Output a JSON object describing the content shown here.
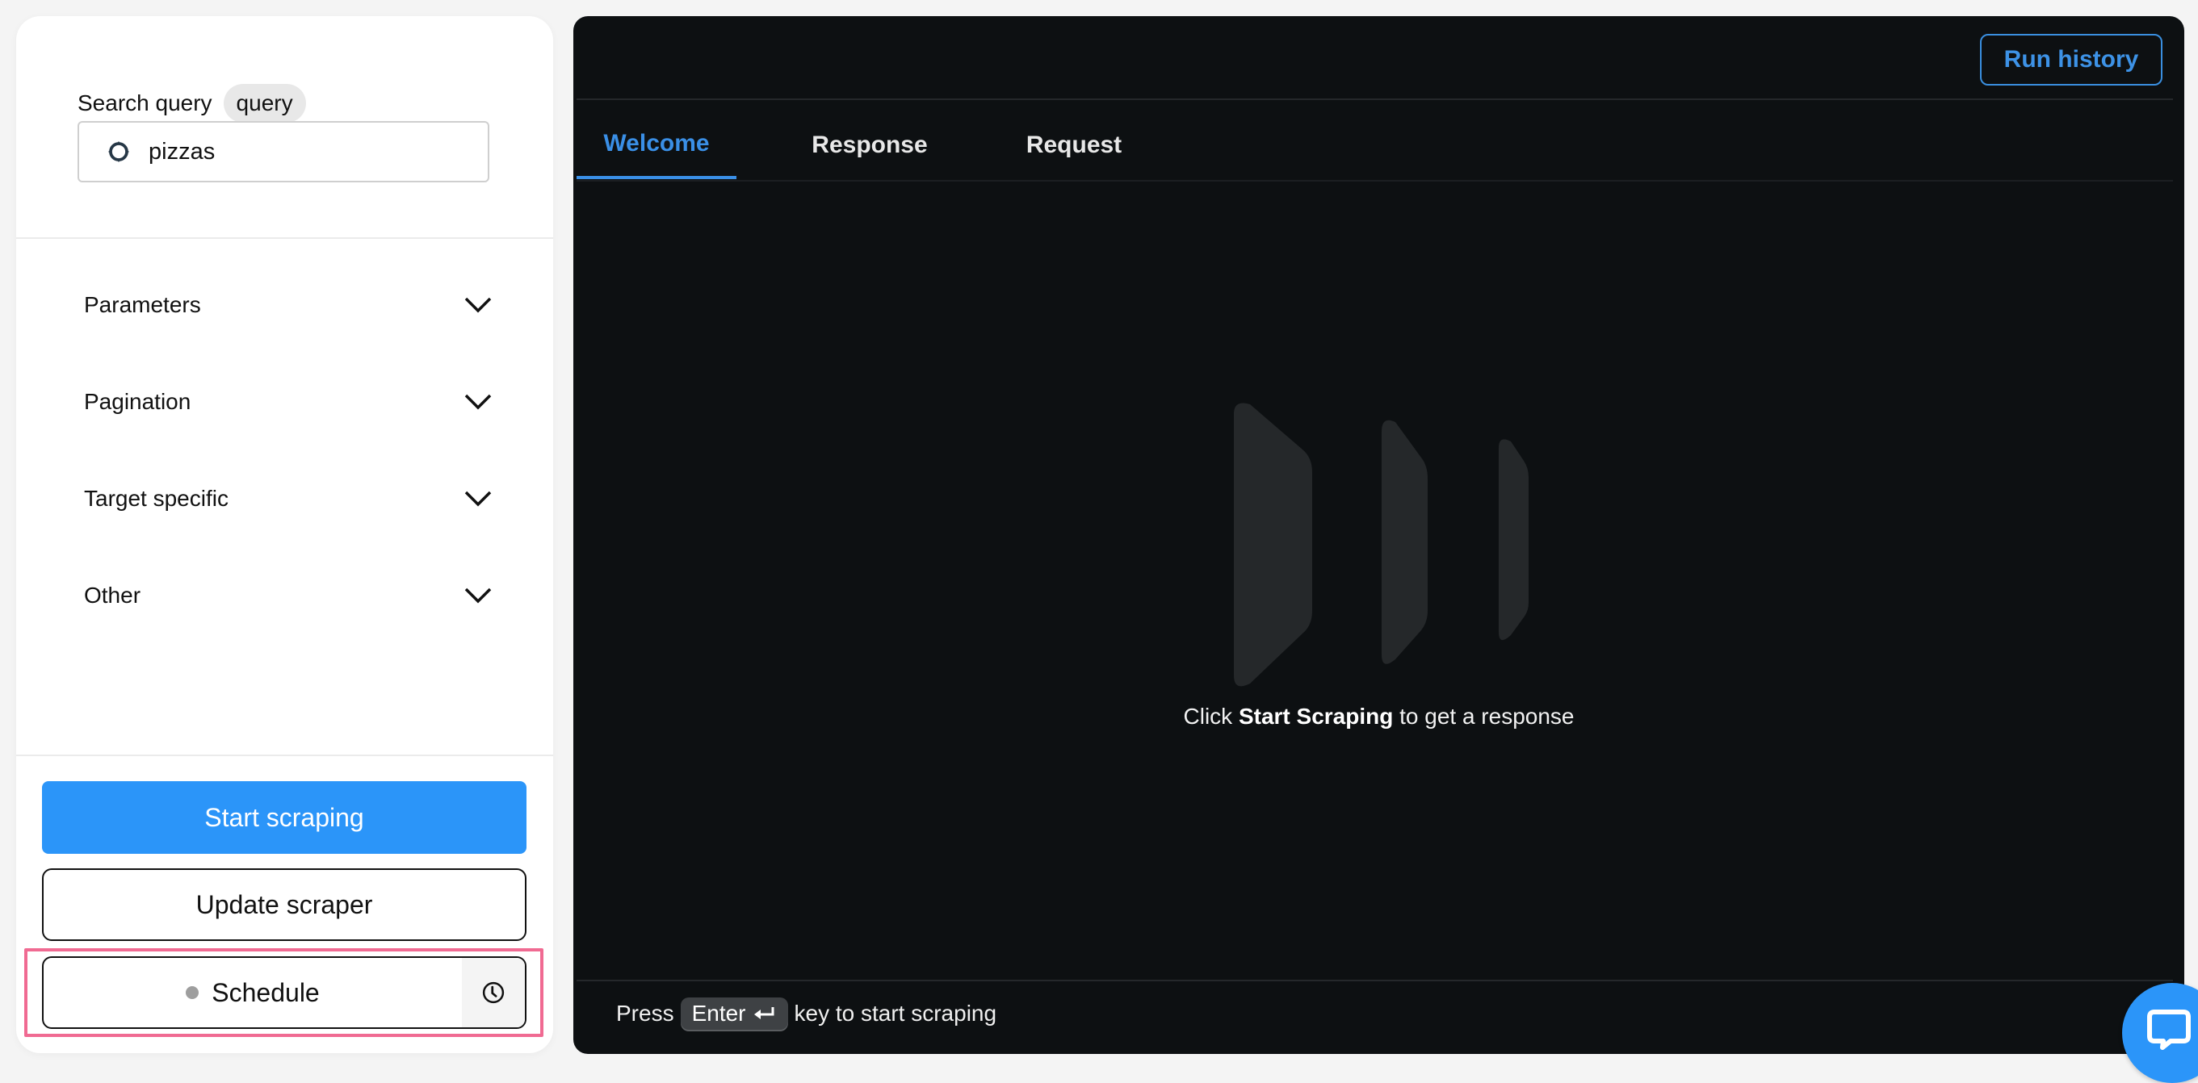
{
  "sidebar": {
    "search": {
      "label": "Search query",
      "chip": "query",
      "value": "pizzas",
      "icon": "target-icon"
    },
    "accordions": [
      {
        "label": "Parameters",
        "icon": "chevron-down-icon"
      },
      {
        "label": "Pagination",
        "icon": "chevron-down-icon"
      },
      {
        "label": "Target specific",
        "icon": "chevron-down-icon"
      },
      {
        "label": "Other",
        "icon": "chevron-down-icon"
      }
    ],
    "buttons": {
      "start": "Start scraping",
      "update": "Update scraper",
      "schedule": "Schedule",
      "schedule_icon": "clock-icon"
    }
  },
  "main": {
    "run_history": "Run history",
    "tabs": [
      {
        "label": "Welcome",
        "active": true
      },
      {
        "label": "Response",
        "active": false
      },
      {
        "label": "Request",
        "active": false
      }
    ],
    "empty_state": {
      "prefix": "Click",
      "bold": "Start Scraping",
      "suffix": "to get a response"
    },
    "footer": {
      "prefix": "Press",
      "key": "Enter",
      "suffix": "key to start scraping"
    }
  },
  "colors": {
    "accent": "#2b95f9",
    "dark_bg": "#0d1012",
    "highlight": "#f06a92"
  },
  "chat_widget": {
    "icon": "chat-icon"
  }
}
